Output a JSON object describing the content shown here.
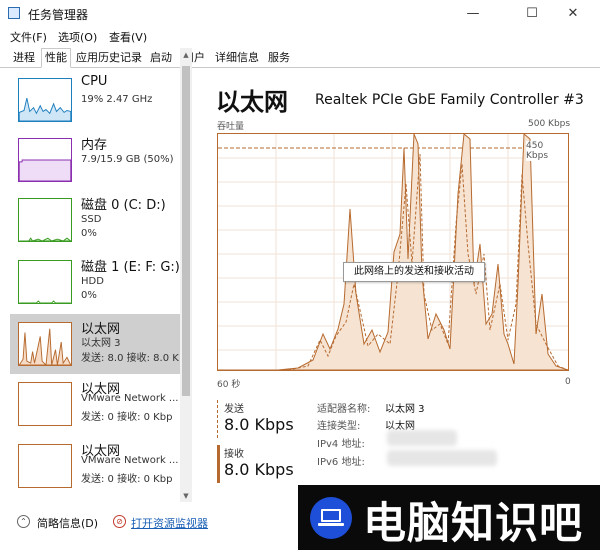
{
  "window": {
    "title": "任务管理器",
    "controls": {
      "minimize": "—",
      "maximize": "☐",
      "close": "✕"
    }
  },
  "menu": [
    "文件(F)",
    "选项(O)",
    "查看(V)"
  ],
  "tabs": [
    {
      "label": "进程",
      "active": false
    },
    {
      "label": "性能",
      "active": true
    },
    {
      "label": "应用历史记录",
      "active": false
    },
    {
      "label": "启动",
      "active": false
    },
    {
      "label": "用户",
      "active": false
    },
    {
      "label": "详细信息",
      "active": false
    },
    {
      "label": "服务",
      "active": false
    }
  ],
  "resources": [
    {
      "title": "CPU",
      "sub1": "19% 2.47 GHz",
      "sub2": "",
      "color": "#1e7fbf",
      "selected": false
    },
    {
      "title": "内存",
      "sub1": "7.9/15.9 GB (50%)",
      "sub2": "",
      "color": "#8b2fb0",
      "selected": false
    },
    {
      "title": "磁盘 0 (C: D:)",
      "sub1": "SSD",
      "sub2": "0%",
      "color": "#3a9b22",
      "selected": false
    },
    {
      "title": "磁盘 1 (E: F: G:)",
      "sub1": "HDD",
      "sub2": "0%",
      "color": "#3a9b22",
      "selected": false
    },
    {
      "title": "以太网",
      "sub1": "以太网 3",
      "sub2": "发送: 8.0 接收: 8.0 K",
      "color": "#b66a2f",
      "selected": true
    },
    {
      "title": "以太网",
      "sub1": "VMware Network ...",
      "sub2": "发送: 0 接收: 0 Kbp",
      "color": "#b66a2f",
      "selected": false
    },
    {
      "title": "以太网",
      "sub1": "VMware Network ...",
      "sub2": "发送: 0 接收: 0 Kbp",
      "color": "#b66a2f",
      "selected": false
    }
  ],
  "detail": {
    "heading": "以太网",
    "adapter_model": "Realtek PCIe GbE Family Controller #3",
    "throughput_label": "吞吐量",
    "max_label": "500 Kbps",
    "mid_label": "450 Kbps",
    "time_left": "60 秒",
    "time_right": "0",
    "tooltip": "此网络上的发送和接收活动",
    "send_label": "发送",
    "send_value": "8.0 Kbps",
    "recv_label": "接收",
    "recv_value": "8.0 Kbps",
    "info": [
      {
        "key": "适配器名称:",
        "value": "以太网 3"
      },
      {
        "key": "连接类型:",
        "value": "以太网"
      },
      {
        "key": "IPv4 地址:",
        "value": ""
      },
      {
        "key": "IPv6 地址:",
        "value": ""
      }
    ],
    "accent": "#b66a2f"
  },
  "footer": {
    "summary_label": "简略信息(D)",
    "monitor_label": "打开资源监视器"
  },
  "watermark": {
    "text": "电脑知识吧"
  }
}
